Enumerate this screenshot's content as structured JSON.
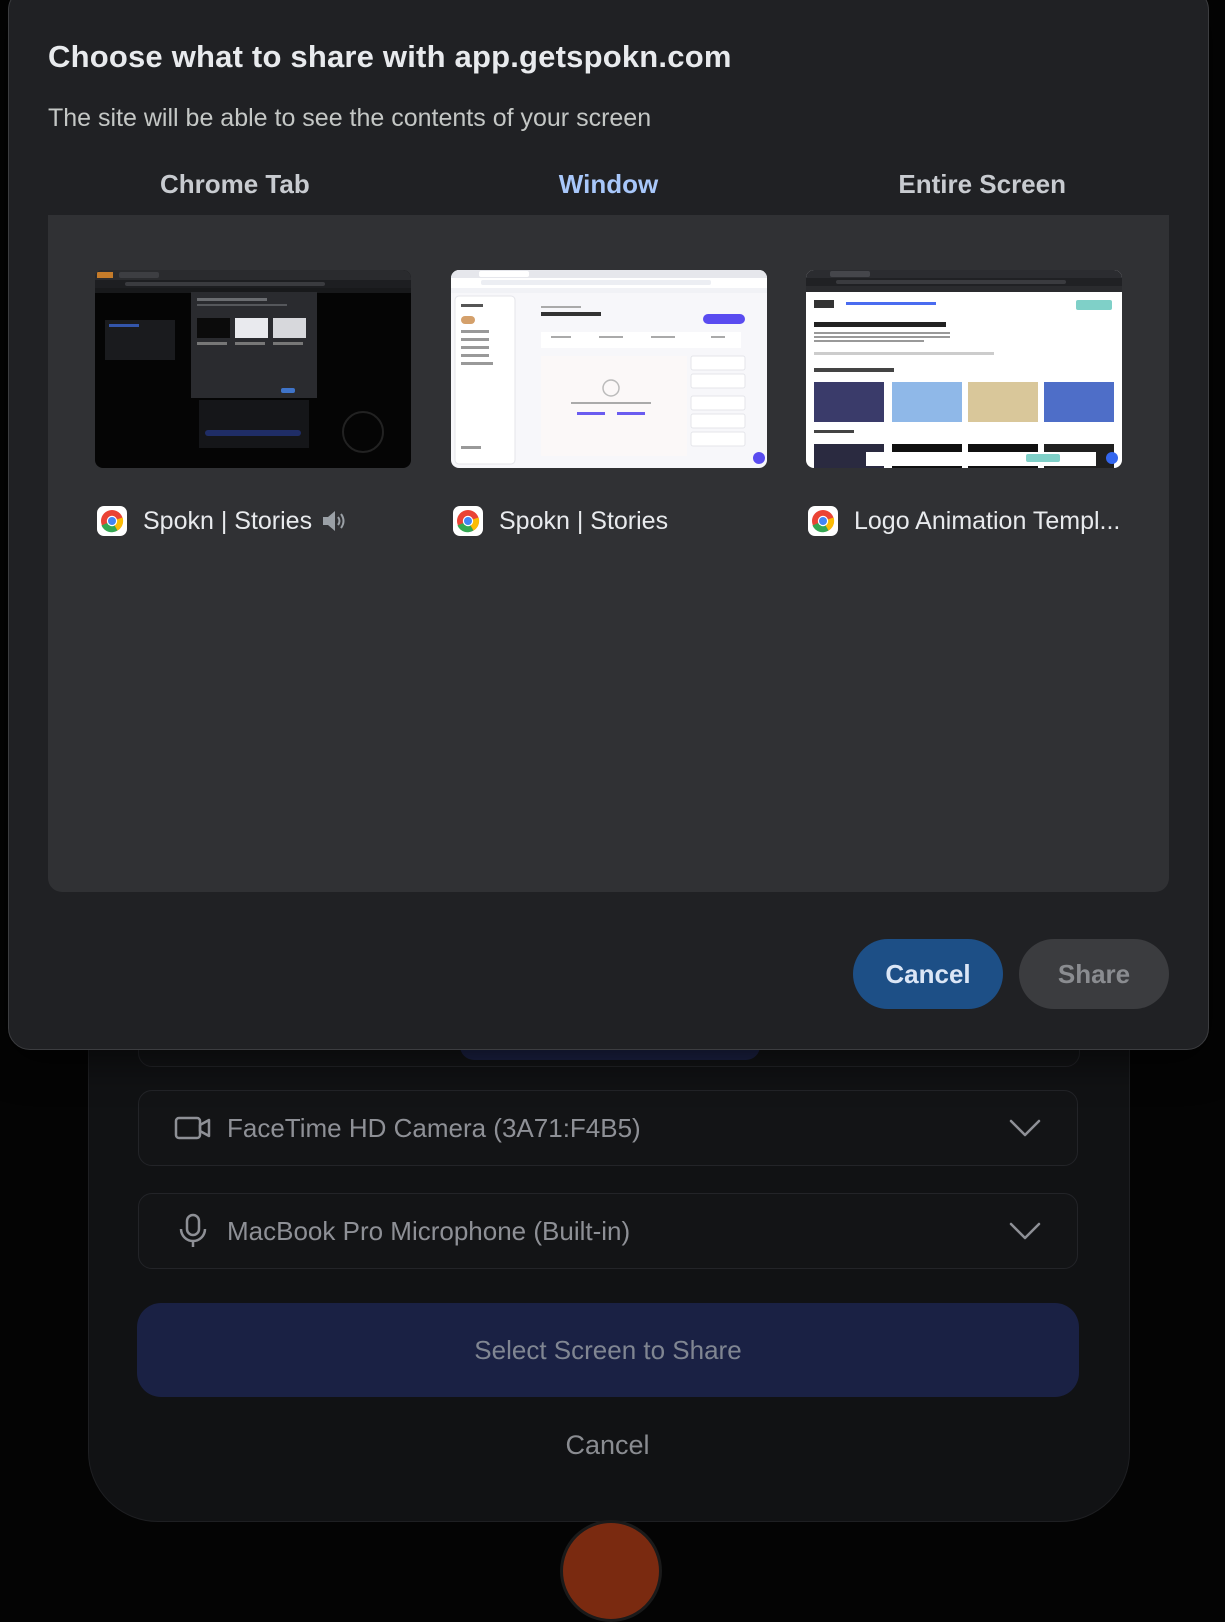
{
  "dialog": {
    "title": "Choose what to share with app.getspokn.com",
    "subtitle": "The site will be able to see the contents of your screen",
    "tabs": [
      {
        "label": "Chrome Tab",
        "active": false
      },
      {
        "label": "Window",
        "active": true
      },
      {
        "label": "Entire Screen",
        "active": false
      }
    ],
    "sources": [
      {
        "title": "Spokn | Stories",
        "icon": "chrome-icon",
        "audio_icon": "speaker-icon"
      },
      {
        "title": "Spokn | Stories",
        "icon": "chrome-icon"
      },
      {
        "title": "Logo Animation Templ...",
        "icon": "chrome-icon"
      }
    ],
    "cancel_label": "Cancel",
    "share_label": "Share"
  },
  "background": {
    "camera_select": "FaceTime HD Camera (3A71:F4B5)",
    "mic_select": "MacBook Pro Microphone (Built-in)",
    "select_screen_label": "Select Screen to Share",
    "cancel_label": "Cancel"
  },
  "colors": {
    "accent": "#a8c7fa",
    "dialog_bg": "#202124",
    "panel_bg": "#303134",
    "primary_button": "#1d4f86",
    "select_screen_button": "#1a2144"
  }
}
